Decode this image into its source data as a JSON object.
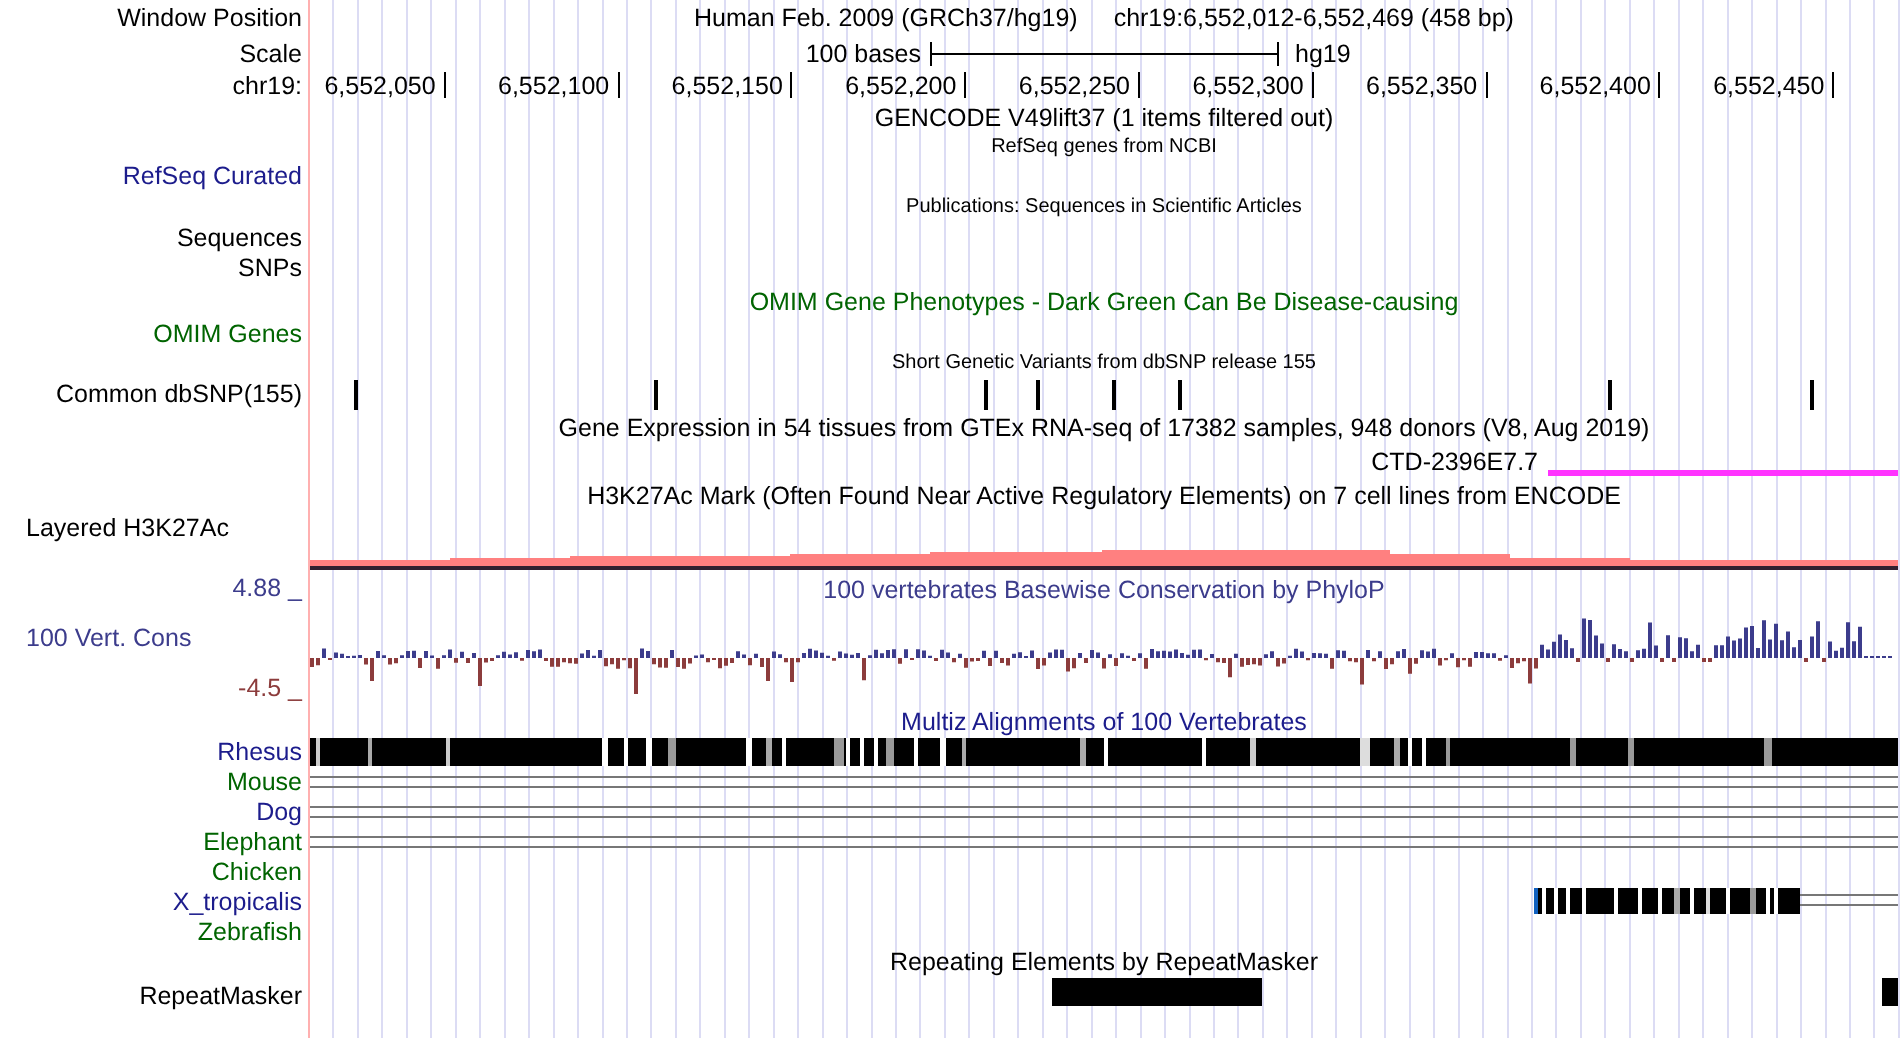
{
  "header": {
    "label": "Window Position",
    "title": "Human Feb. 2009 (GRCh37/hg19)",
    "position": "chr19:6,552,012-6,552,469 (458 bp)"
  },
  "scale": {
    "label": "Scale",
    "length": "100 bases",
    "assembly": "hg19"
  },
  "ruler": {
    "label": "chr19:",
    "ticks": [
      "6,552,050",
      "6,552,100",
      "6,552,150",
      "6,552,200",
      "6,552,250",
      "6,552,300",
      "6,552,350",
      "6,552,400",
      "6,552,450"
    ]
  },
  "tracks": [
    {
      "kind": "title",
      "text": "GENCODE V49lift37 (1 items filtered out)",
      "color": "#000000"
    },
    {
      "kind": "caption",
      "text": "RefSeq genes from NCBI"
    },
    {
      "kind": "label",
      "label": "RefSeq Curated",
      "color": "#1c1c8c"
    },
    {
      "kind": "caption",
      "text": "Publications: Sequences in Scientific Articles"
    },
    {
      "kind": "label",
      "label": "Sequences",
      "color": "#000000"
    },
    {
      "kind": "label",
      "label": "SNPs",
      "color": "#000000"
    },
    {
      "kind": "title",
      "text": "OMIM Gene Phenotypes - Dark Green Can Be Disease-causing",
      "color": "#006400"
    },
    {
      "kind": "label",
      "label": "OMIM Genes",
      "color": "#006400"
    },
    {
      "kind": "caption",
      "text": "Short Genetic Variants from dbSNP release 155"
    },
    {
      "kind": "snps",
      "label": "Common dbSNP(155)",
      "color": "#000000"
    },
    {
      "kind": "title",
      "text": "Gene Expression in 54 tissues from GTEx RNA-seq of 17382 samples, 948 donors (V8, Aug 2019)",
      "color": "#000000"
    },
    {
      "kind": "gene",
      "name": "CTD-2396E7.7",
      "color": "#ff33ff"
    },
    {
      "kind": "title",
      "text": "H3K27Ac Mark (Often Found Near Active Regulatory Elements) on 7 cell lines from ENCODE",
      "color": "#000000"
    },
    {
      "kind": "signal",
      "label": "Layered H3K27Ac",
      "color": "#000000"
    },
    {
      "kind": "phylop",
      "label": "100 Vert. Cons",
      "title": "100 vertebrates Basewise Conservation by PhyloP",
      "color": "#3c3c8c",
      "max_label": {
        "text": "4.88 _",
        "color": "#3c3c8c"
      },
      "min_label": {
        "text": "-4.5 _",
        "color": "#8c3c3c"
      }
    },
    {
      "kind": "title",
      "text": "Multiz Alignments of 100 Vertebrates",
      "color": "#1c1c8c"
    },
    {
      "kind": "species-blocks",
      "label": "Rhesus",
      "color": "#1c1c8c"
    },
    {
      "kind": "species-lines",
      "label": "Mouse",
      "color": "#006400"
    },
    {
      "kind": "species-lines",
      "label": "Dog",
      "color": "#1c1c8c"
    },
    {
      "kind": "species-lines",
      "label": "Elephant",
      "color": "#006400"
    },
    {
      "kind": "species",
      "label": "Chicken",
      "color": "#006400"
    },
    {
      "kind": "species-partial",
      "label": "X_tropicalis",
      "color": "#1c1c8c"
    },
    {
      "kind": "species",
      "label": "Zebrafish",
      "color": "#006400"
    },
    {
      "kind": "title",
      "text": "Repeating Elements by RepeatMasker",
      "color": "#000000"
    },
    {
      "kind": "repeat",
      "label": "RepeatMasker",
      "color": "#000000"
    }
  ]
}
